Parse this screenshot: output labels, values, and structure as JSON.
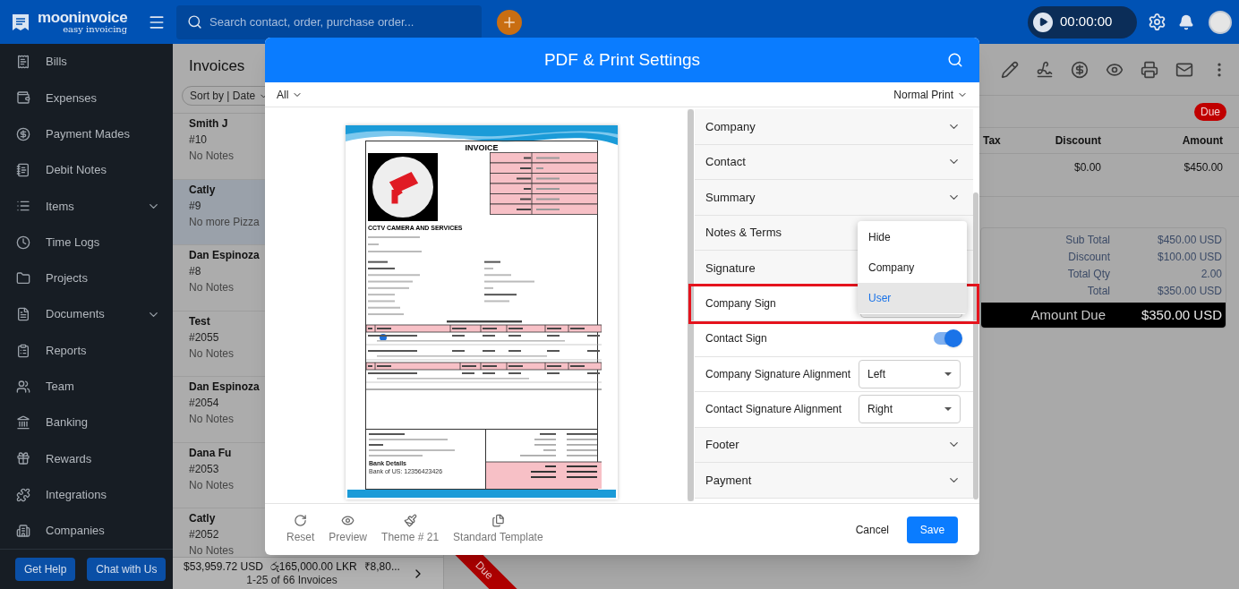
{
  "topbar": {
    "logo_name": "mooninvoice",
    "logo_tagline": "easy invoicing",
    "search_placeholder": "Search contact, order, purchase order...",
    "timer": "00:00:00"
  },
  "sidebar": {
    "items": [
      {
        "label": "Bills",
        "expandable": false
      },
      {
        "label": "Expenses",
        "expandable": false
      },
      {
        "label": "Payment Mades",
        "expandable": false
      },
      {
        "label": "Debit Notes",
        "expandable": false
      },
      {
        "label": "Items",
        "expandable": true
      },
      {
        "label": "Time Logs",
        "expandable": false
      },
      {
        "label": "Projects",
        "expandable": false
      },
      {
        "label": "Documents",
        "expandable": true
      },
      {
        "label": "Reports",
        "expandable": false
      },
      {
        "label": "Team",
        "expandable": false
      },
      {
        "label": "Banking",
        "expandable": false
      },
      {
        "label": "Rewards",
        "expandable": false
      },
      {
        "label": "Integrations",
        "expandable": false
      },
      {
        "label": "Companies",
        "expandable": false
      }
    ],
    "buttons": [
      "Get Help",
      "Chat with Us"
    ]
  },
  "invoice_list": {
    "title": "Invoices",
    "sort": "Sort by | Date",
    "items": [
      {
        "name": "Smith J",
        "number": "#10",
        "note": "No Notes",
        "selected": false
      },
      {
        "name": "Catly",
        "number": "#9",
        "note": "No more Pizza",
        "selected": true
      },
      {
        "name": "Dan Espinoza",
        "number": "#8",
        "note": "No Notes",
        "selected": false
      },
      {
        "name": "Test",
        "number": "#2055",
        "note": "No Notes",
        "selected": false
      },
      {
        "name": "Dan Espinoza",
        "number": "#2054",
        "note": "No Notes",
        "selected": false
      },
      {
        "name": "Dana Fu",
        "number": "#2053",
        "note": "No Notes",
        "selected": false
      },
      {
        "name": "Catly",
        "number": "#2052",
        "note": "No Notes",
        "selected": false
      }
    ],
    "totals": [
      "$53,959.72 USD",
      "රු165,000.00 LKR",
      "₹8,80..."
    ],
    "count": "1-25 of 66 Invoices"
  },
  "detail": {
    "status": "Due",
    "columns": [
      "Tax",
      "Discount",
      "Amount"
    ],
    "row": [
      "$0.00",
      "$450.00"
    ],
    "summary": [
      {
        "label": "Sub Total",
        "value": "$450.00 USD"
      },
      {
        "label": "Discount",
        "value": "$100.00 USD"
      },
      {
        "label": "Total Qty",
        "value": "2.00"
      },
      {
        "label": "Total",
        "value": "$350.00 USD"
      }
    ],
    "amount_due": {
      "label": "Amount Due",
      "value": "$350.00 USD"
    },
    "ribbon": "Due"
  },
  "dialog": {
    "title": "PDF & Print Settings",
    "filter": "All",
    "print_mode": "Normal Print",
    "settings": [
      {
        "kind": "section",
        "label": "Company",
        "expanded": false
      },
      {
        "kind": "section",
        "label": "Contact",
        "expanded": false
      },
      {
        "kind": "section",
        "label": "Summary",
        "expanded": false
      },
      {
        "kind": "section",
        "label": "Notes & Terms"
      },
      {
        "kind": "section",
        "label": "Signature"
      },
      {
        "kind": "select",
        "label": "Company Sign",
        "highlighted": true
      },
      {
        "kind": "toggle",
        "label": "Contact Sign",
        "on": true
      },
      {
        "kind": "select",
        "label": "Company Signature Alignment",
        "value": "Left",
        "highlighted": false
      },
      {
        "kind": "select",
        "label": "Contact Signature Alignment",
        "value": "Right",
        "highlighted": false
      },
      {
        "kind": "section",
        "label": "Footer",
        "expanded": false
      },
      {
        "kind": "section",
        "label": "Payment",
        "expanded": false
      }
    ],
    "menu": [
      {
        "label": "Hide",
        "selected": false
      },
      {
        "label": "Company",
        "selected": false
      },
      {
        "label": "User",
        "selected": true
      }
    ],
    "tools": [
      {
        "kind": "reset",
        "label": "Reset"
      },
      {
        "kind": "preview",
        "label": "Preview"
      },
      {
        "kind": "theme",
        "label": "Theme # 21"
      },
      {
        "kind": "template",
        "label": "Standard Template"
      }
    ],
    "actions": [
      {
        "kind": "cancel",
        "label": "Cancel"
      },
      {
        "kind": "save",
        "label": "Save"
      }
    ],
    "invoice": {
      "title": "INVOICE",
      "company": "CCTV CAMERA AND SERVICES",
      "bank_heading": "Bank Details",
      "bank": "Bank of US: 12356423426"
    }
  }
}
